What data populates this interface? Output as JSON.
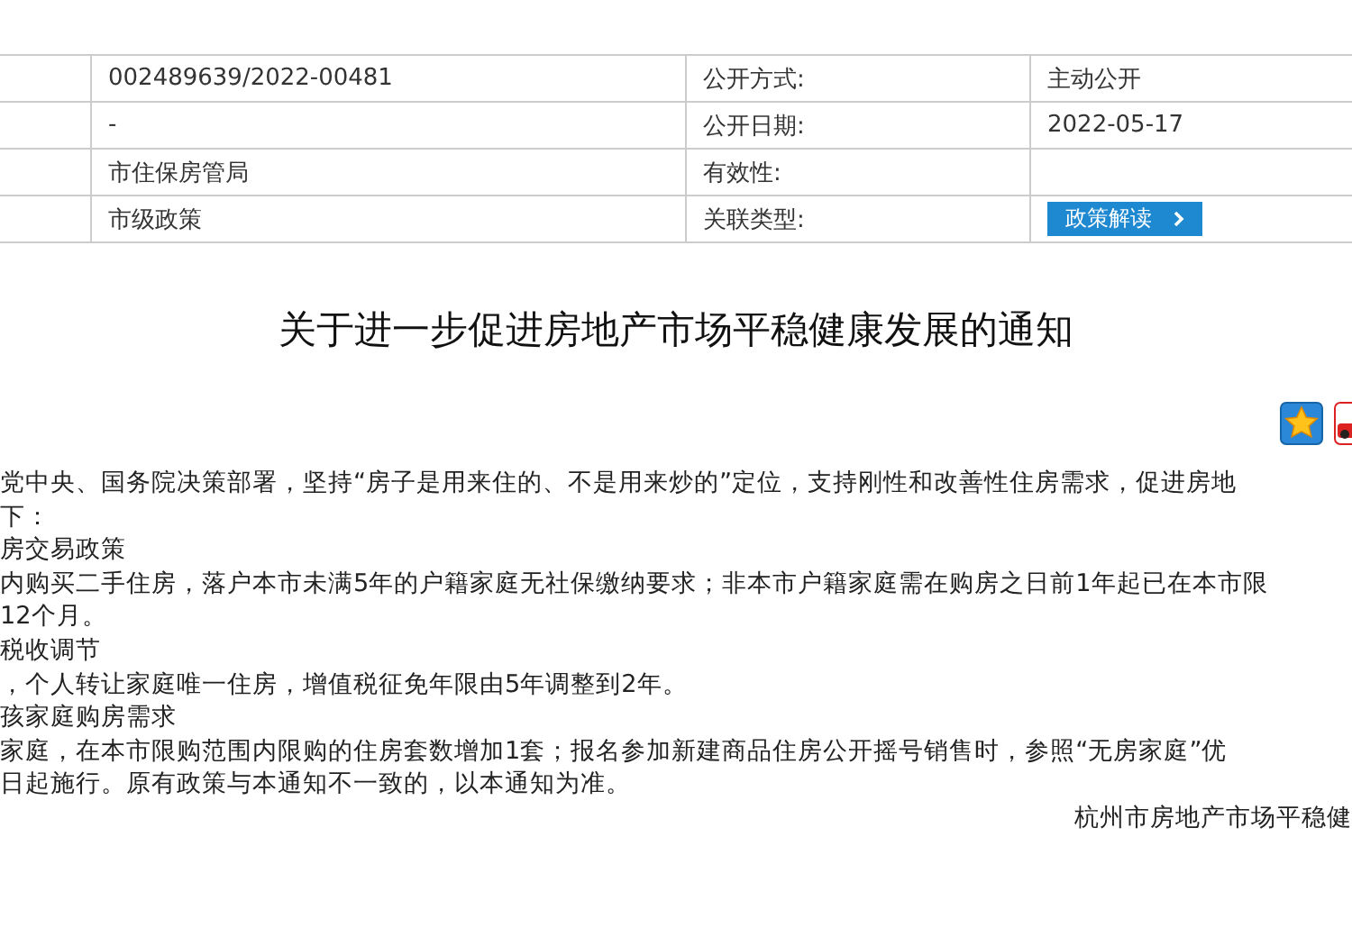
{
  "meta_table": {
    "rows": [
      {
        "value": "002489639/2022-00481",
        "label": "公开方式:",
        "kind": "text",
        "label_value": "主动公开"
      },
      {
        "value": "-",
        "label": "公开日期:",
        "kind": "text",
        "label_value": "2022-05-17"
      },
      {
        "value": "市住保房管局",
        "label": "有效性:",
        "kind": "empty"
      },
      {
        "value": "市级政策",
        "label": "关联类型:",
        "kind": "button",
        "label_value": "政策解读"
      }
    ]
  },
  "title": "关于进一步促进房地产市场平稳健康发展的通知",
  "body": {
    "paragraphs": [
      {
        "text": "党中央、国务院决策部署，坚持“房子是用来住的、不是用来炒的”定位，支持刚性和改善性住房需求，促进房地",
        "kind": "line"
      },
      {
        "text": "下：",
        "kind": "line"
      },
      {
        "text": "房交易政策",
        "kind": "line"
      },
      {
        "text": "内购买二手住房，落户本市未满5年的户籍家庭无社保缴纳要求；非本市户籍家庭需在购房之日前1年起已在本市限",
        "kind": "line"
      },
      {
        "text": "12个月。",
        "kind": "line"
      },
      {
        "text": "税收调节",
        "kind": "line"
      },
      {
        "text": "，个人转让家庭唯一住房，增值税征免年限由5年调整到2年。",
        "kind": "line"
      },
      {
        "text": "孩家庭购房需求",
        "kind": "line"
      },
      {
        "text": "家庭，在本市限购范围内限购的住房套数增加1套；报名参加新建商品住房公开摇号销售时，参照“无房家庭”优",
        "kind": "line"
      },
      {
        "text": "日起施行。原有政策与本通知不一致的，以本通知为准。",
        "kind": "line"
      },
      {
        "text": "杭州市房地产市场平稳健",
        "kind": "signature"
      }
    ]
  }
}
